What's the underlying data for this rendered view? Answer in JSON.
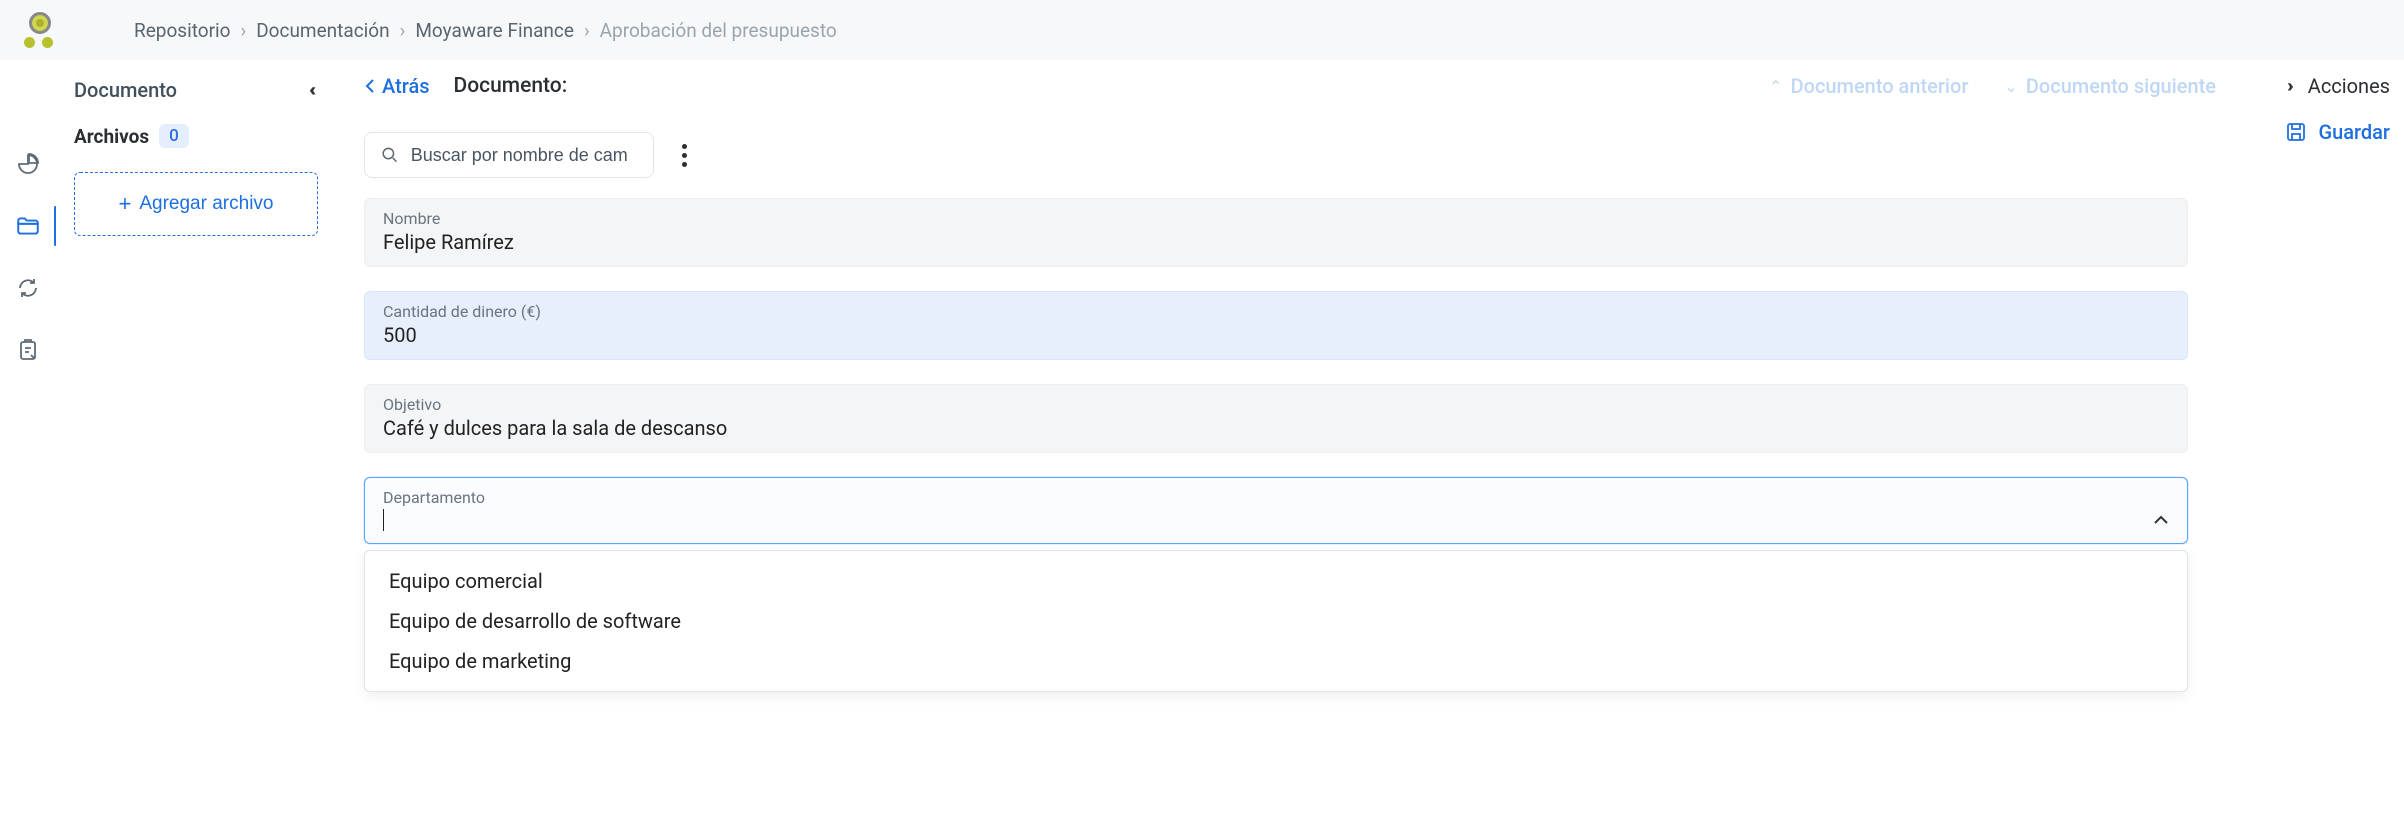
{
  "breadcrumb": {
    "items": [
      {
        "label": "Repositorio"
      },
      {
        "label": "Documentación"
      },
      {
        "label": "Moyaware Finance"
      },
      {
        "label": "Aprobación del presupuesto",
        "current": true
      }
    ]
  },
  "sidepanel": {
    "title": "Documento",
    "files_label": "Archivos",
    "files_count": "0",
    "add_file_label": "Agregar archivo"
  },
  "main": {
    "back_label": "Atrás",
    "doc_label": "Documento:",
    "prev_doc_label": "Documento anterior",
    "next_doc_label": "Documento siguiente",
    "search_placeholder": "Buscar por nombre de cam"
  },
  "actions": {
    "actions_label": "Acciones",
    "save_label": "Guardar"
  },
  "form": {
    "name": {
      "label": "Nombre",
      "value": "Felipe Ramírez"
    },
    "amount": {
      "label": "Cantidad de dinero (€)",
      "value": "500"
    },
    "goal": {
      "label": "Objetivo",
      "value": "Café y dulces para la sala de descanso"
    },
    "department": {
      "label": "Departamento",
      "value": "",
      "options": [
        "Equipo comercial",
        "Equipo de desarrollo de software",
        "Equipo de marketing"
      ]
    }
  }
}
